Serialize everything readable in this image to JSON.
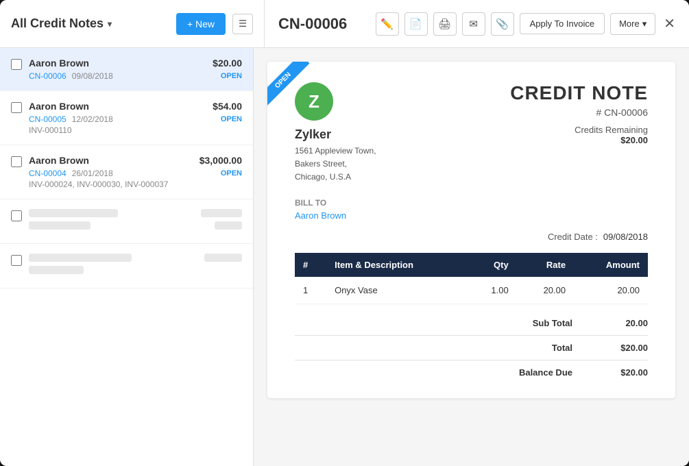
{
  "header": {
    "title": "All Credit Notes",
    "new_label": "+ New",
    "invoice_id": "CN-00006",
    "apply_label": "Apply To Invoice",
    "more_label": "More"
  },
  "list": {
    "items": [
      {
        "name": "Aaron Brown",
        "amount": "$20.00",
        "id": "CN-00006",
        "date": "09/08/2018",
        "status": "OPEN",
        "sub": ""
      },
      {
        "name": "Aaron Brown",
        "amount": "$54.00",
        "id": "CN-00005",
        "date": "12/02/2018",
        "status": "OPEN",
        "sub": "INV-000110"
      },
      {
        "name": "Aaron Brown",
        "amount": "$3,000.00",
        "id": "CN-00004",
        "date": "26/01/2018",
        "status": "OPEN",
        "sub": "INV-000024, INV-000030, INV-000037"
      }
    ]
  },
  "document": {
    "ribbon": "Open",
    "company_initial": "Z",
    "company_name": "Zylker",
    "address_line1": "1561 Appleview Town,",
    "address_line2": "Bakers Street,",
    "address_line3": "Chicago, U.S.A",
    "doc_title": "CREDIT NOTE",
    "doc_number": "# CN-00006",
    "credits_remaining_label": "Credits Remaining",
    "credits_remaining_value": "$20.00",
    "bill_to_label": "Bill To",
    "bill_to_name": "Aaron Brown",
    "credit_date_label": "Credit Date :",
    "credit_date_value": "09/08/2018",
    "table": {
      "columns": [
        "#",
        "Item & Description",
        "Qty",
        "Rate",
        "Amount"
      ],
      "rows": [
        {
          "num": "1",
          "description": "Onyx Vase",
          "qty": "1.00",
          "rate": "20.00",
          "amount": "20.00"
        }
      ]
    },
    "sub_total_label": "Sub Total",
    "sub_total_value": "20.00",
    "total_label": "Total",
    "total_value": "$20.00",
    "balance_due_label": "Balance Due",
    "balance_due_value": "$20.00"
  }
}
